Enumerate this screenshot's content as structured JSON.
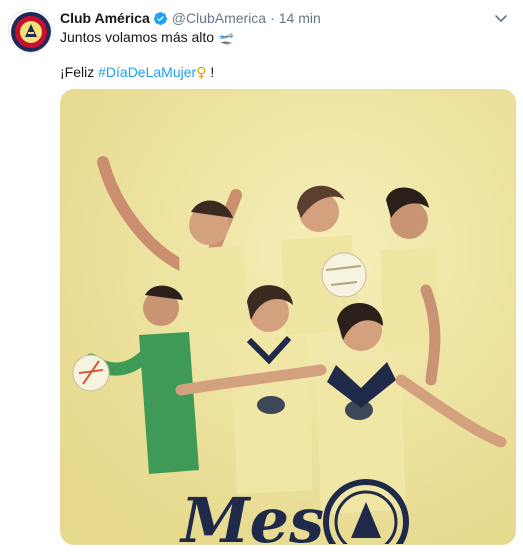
{
  "tweet": {
    "display_name": "Club América",
    "handle": "@ClubAmerica",
    "separator": "·",
    "time": "14 min",
    "line1": "Juntos volamos más alto",
    "line1_emoji": "🛫",
    "greeting_prefix": "¡Feliz ",
    "hashtag": "#DíaDeLaMujer",
    "emoji": "♀",
    "greeting_suffix": " !",
    "banner_text": "Mes",
    "icons": {
      "verified": "verified-badge-icon",
      "more": "chevron-down-icon",
      "avatar": "club-america-crest-icon"
    },
    "colors": {
      "link": "#1da1f2",
      "muted": "#657786",
      "image_bg": "#ecdf9a",
      "jersey": "#f0e6a6",
      "navy": "#1f2a4a"
    }
  }
}
